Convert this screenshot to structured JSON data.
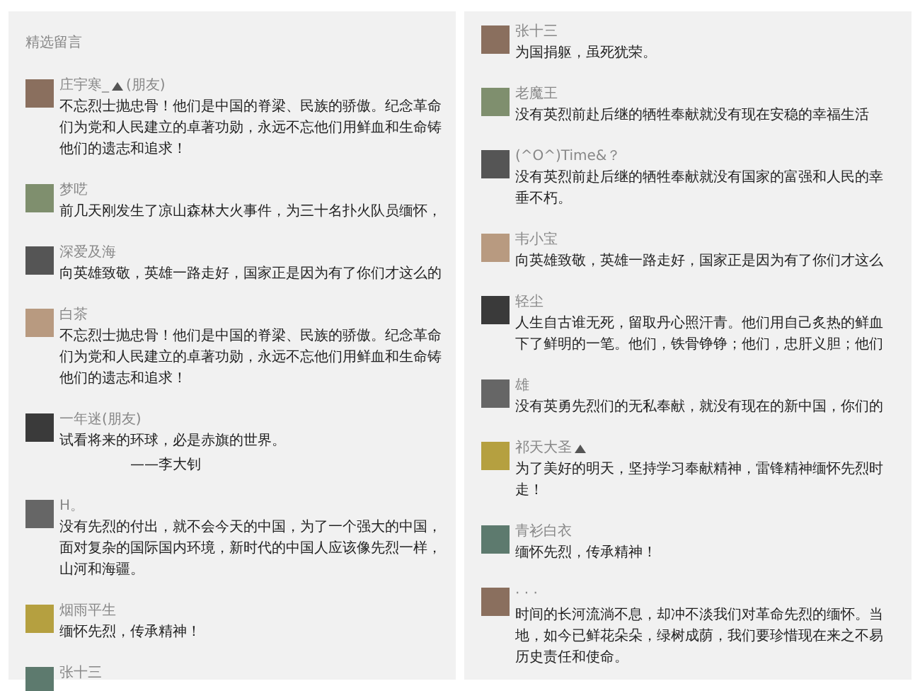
{
  "panels": [
    {
      "header": "精选留言",
      "comments": [
        {
          "name": "庄宇寒_",
          "emoji": true,
          "tag": "(朋友)",
          "lines": [
            "不忘烈士抛忠骨！他们是中国的脊梁、民族的骄傲。纪念革命",
            "们为党和人民建立的卓著功勋，永远不忘他们用鲜血和生命铸",
            "他们的遗志和追求！"
          ]
        },
        {
          "name": "梦呓",
          "lines": [
            "前几天刚发生了凉山森林大火事件，为三十名扑火队员缅怀，"
          ]
        },
        {
          "name": "深爱及海",
          "lines": [
            "向英雄致敬，英雄一路走好，国家正是因为有了你们才这么的"
          ]
        },
        {
          "name": "白茶",
          "lines": [
            "不忘烈士抛忠骨！他们是中国的脊梁、民族的骄傲。纪念革命",
            "们为党和人民建立的卓著功勋，永远不忘他们用鲜血和生命铸",
            "他们的遗志和追求！"
          ]
        },
        {
          "name": "一年迷(朋友)",
          "lines": [
            "试看将来的环球，必是赤旗的世界。"
          ],
          "attribution": "——李大钊"
        },
        {
          "name": "H。",
          "lines": [
            "没有先烈的付出，就不会今天的中国，为了一个强大的中国，",
            "面对复杂的国际国内环境，新时代的中国人应该像先烈一样，",
            "山河和海疆。"
          ]
        },
        {
          "name": "烟雨平生",
          "lines": [
            "缅怀先烈，传承精神！"
          ]
        },
        {
          "name": "张十三"
        }
      ]
    },
    {
      "comments": [
        {
          "name": "张十三",
          "lines": [
            "为国捐躯，虽死犹荣。"
          ]
        },
        {
          "name": "老魔王",
          "lines": [
            "没有英烈前赴后继的牺牲奉献就没有现在安稳的幸福生活"
          ]
        },
        {
          "name": "(^O^)Time&？",
          "lines": [
            "没有英烈前赴后继的牺牲奉献就没有国家的富强和人民的幸",
            "垂不朽。"
          ]
        },
        {
          "name": "韦小宝",
          "lines": [
            "向英雄致敬，英雄一路走好，国家正是因为有了你们才这么"
          ]
        },
        {
          "name": "轻尘",
          "lines": [
            "人生自古谁无死，留取丹心照汗青。他们用自己炙热的鲜血",
            "下了鲜明的一笔。他们，铁骨铮铮；他们，忠肝义胆；他们"
          ]
        },
        {
          "name": "雄",
          "lines": [
            "没有英勇先烈们的无私奉献，就没有现在的新中国，你们的"
          ]
        },
        {
          "name": "祁天大圣",
          "emoji": true,
          "lines": [
            "为了美好的明天，坚持学习奉献精神，雷锋精神缅怀先烈时",
            "走！"
          ]
        },
        {
          "name": "青衫白衣",
          "lines": [
            "缅怀先烈，传承精神！"
          ]
        },
        {
          "name": "· · ·",
          "lines": [
            "时间的长河流淌不息，却冲不淡我们对革命先烈的缅怀。当",
            "地，如今已鲜花朵朵，绿树成荫，我们要珍惜现在来之不易",
            "历史责任和使命。"
          ]
        }
      ]
    }
  ]
}
